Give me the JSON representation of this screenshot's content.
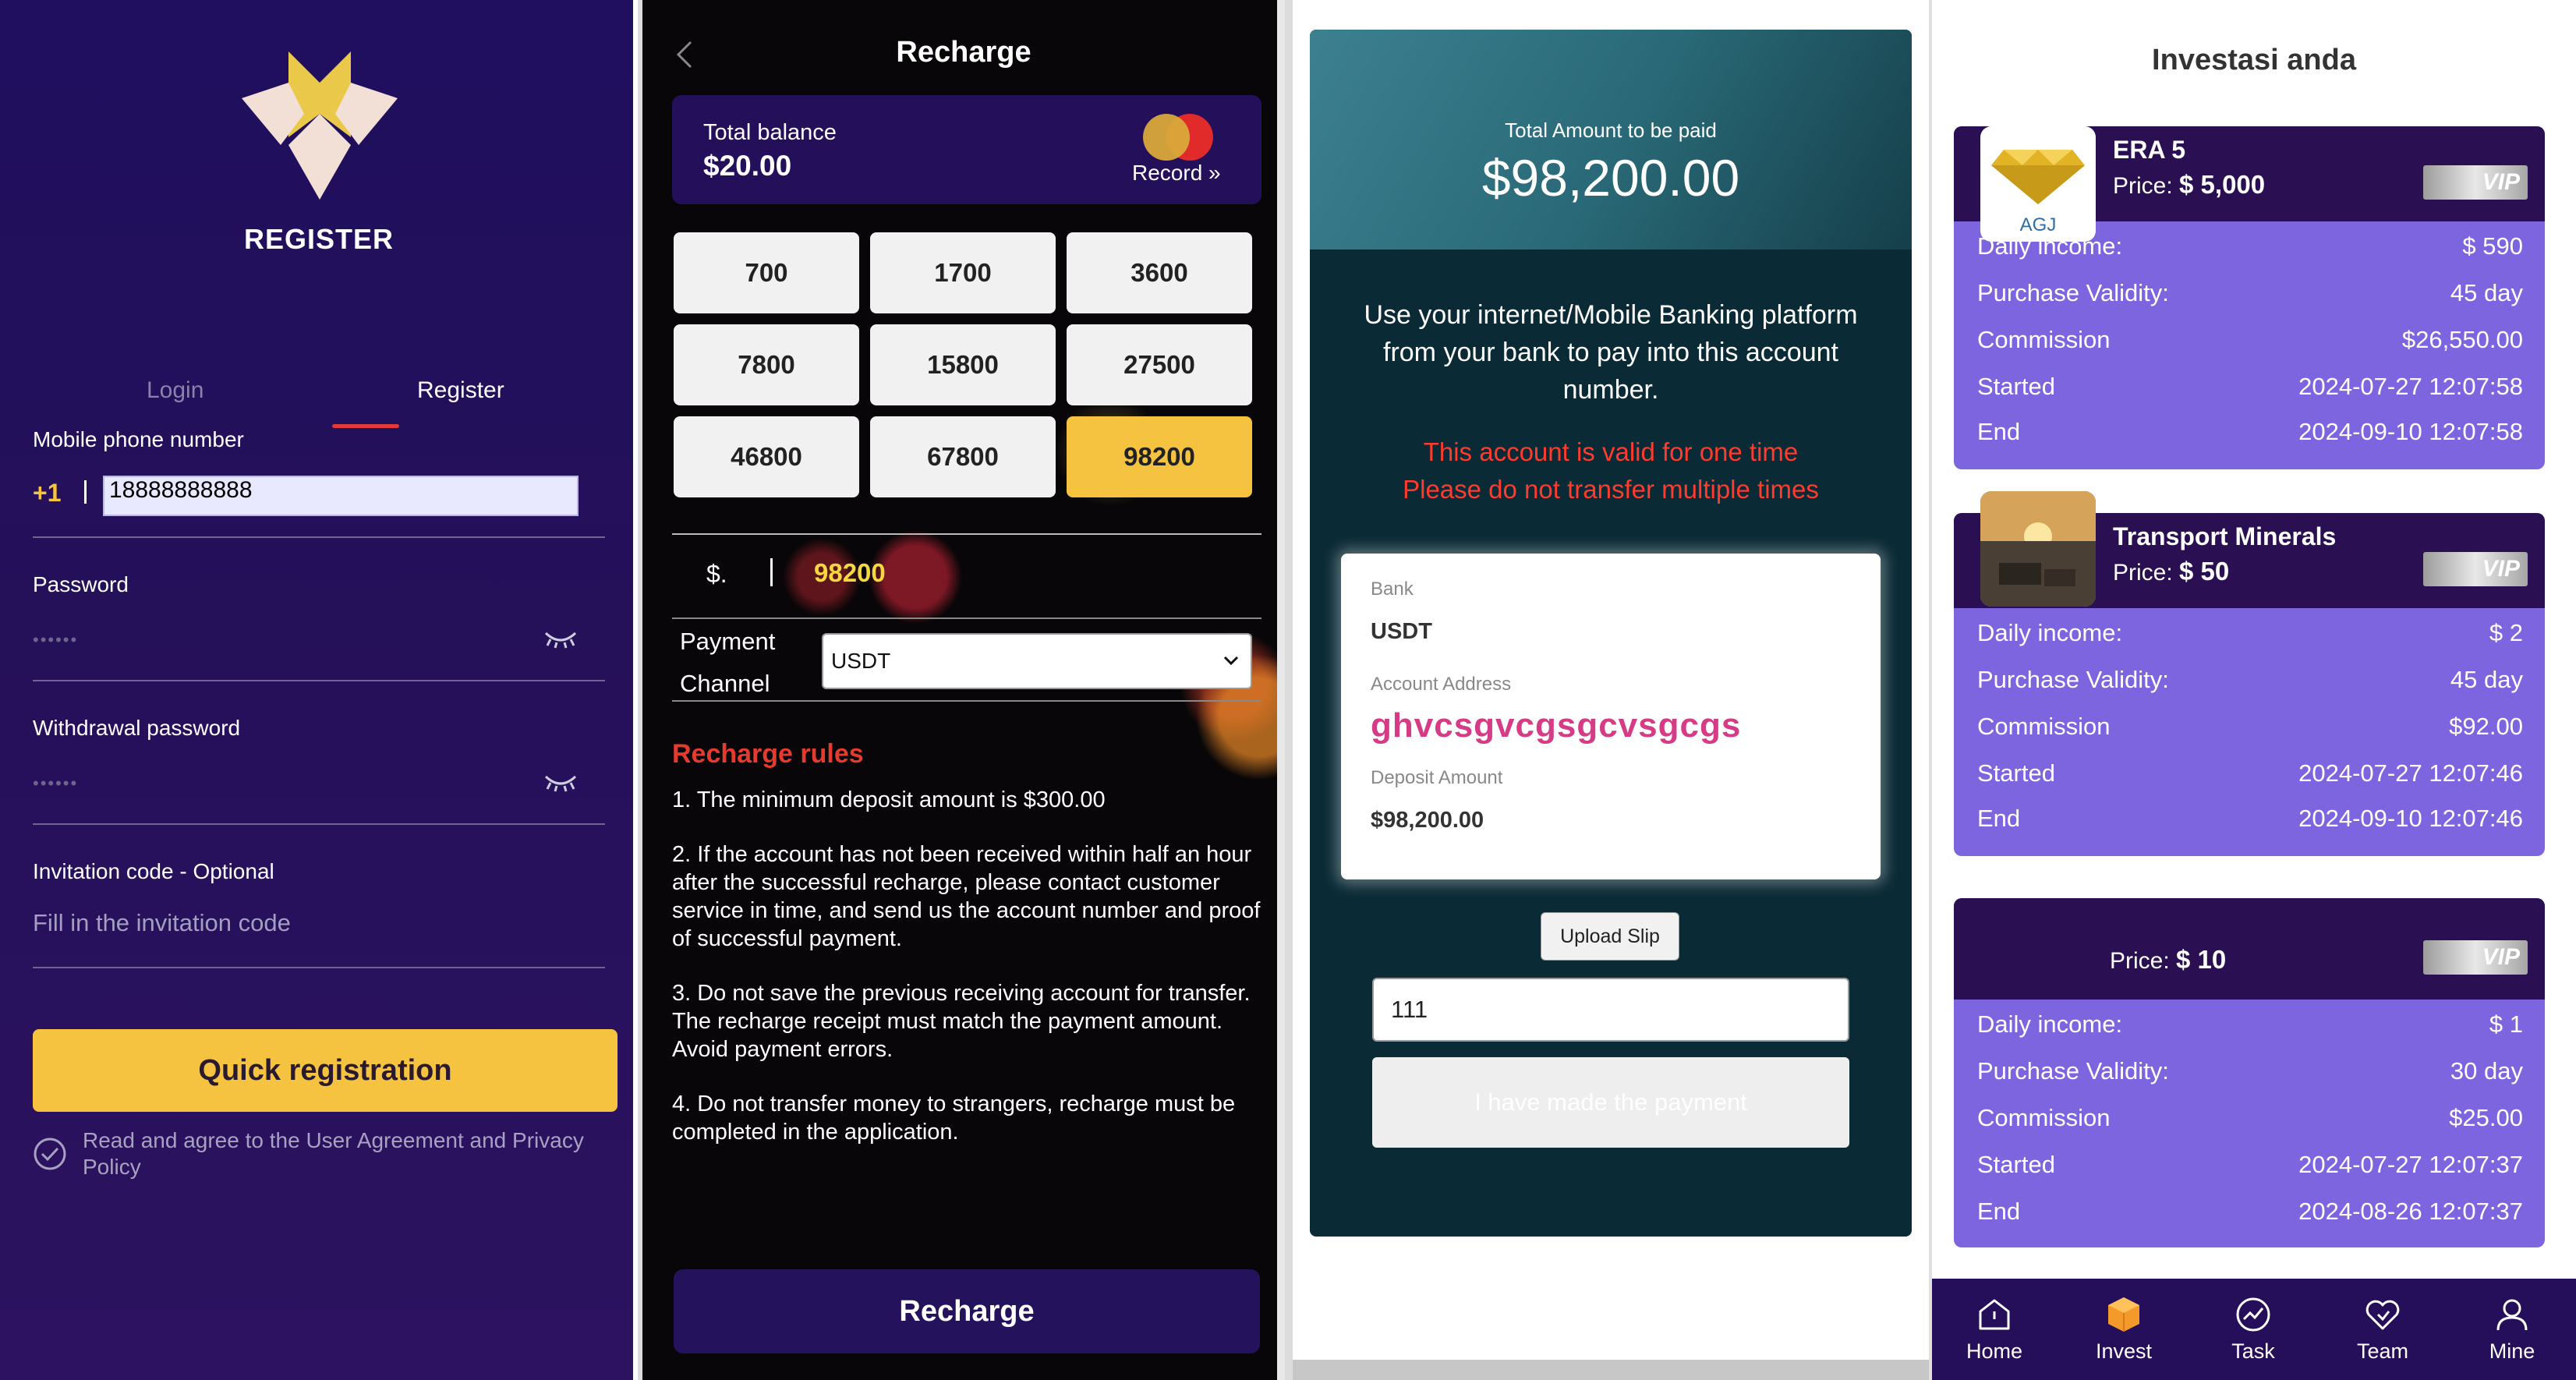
{
  "register": {
    "title": "REGISTER",
    "tab_login": "Login",
    "tab_register": "Register",
    "phone_label": "Mobile phone number",
    "country_code": "+1",
    "phone_value": "18888888888",
    "password_label": "Password",
    "password_dots": "••••••",
    "withdrawal_label": "Withdrawal password",
    "withdrawal_dots": "••••••",
    "invitation_label": "Invitation code - Optional",
    "invitation_placeholder": "Fill in the invitation code",
    "submit": "Quick registration",
    "agreement": "Read and agree to the User Agreement and Privacy Policy",
    "colors": {
      "accent": "#f5c33f",
      "bg": "#1f0f5e",
      "tab_indicator": "#e23a3a"
    }
  },
  "recharge": {
    "title": "Recharge",
    "balance_label": "Total balance",
    "balance_value": "$20.00",
    "record": "Record »",
    "amounts": [
      "700",
      "1700",
      "3600",
      "7800",
      "15800",
      "27500",
      "46800",
      "67800",
      "98200"
    ],
    "selected_amount": "98200",
    "currency_prefix": "$.",
    "amount_value": "98200",
    "payment_channel_label": "Payment Channel",
    "payment_channel_value": "USDT",
    "rules_title": "Recharge rules",
    "rules": [
      "1. The minimum deposit amount is $300.00",
      "2. If the account has not been received within half an hour after the successful recharge, please contact customer service in time, and send us the account number and proof of successful payment.",
      "3. Do not save the previous receiving account for transfer. The recharge receipt must match the payment amount. Avoid payment errors.",
      "4. Do not transfer money to strangers, recharge must be completed in the application."
    ],
    "submit": "Recharge"
  },
  "payment": {
    "total_label": "Total Amount to be paid",
    "total_value": "$98,200.00",
    "instructions": "Use your internet/Mobile Banking platform from your bank to pay into this account number.",
    "warning_line1": "This account is valid for one time",
    "warning_line2": "Please do not transfer multiple times",
    "bank_label": "Bank",
    "bank_value": "USDT",
    "address_label": "Account Address",
    "address_value": "ghvcsgvcgsgcvsgcgs",
    "deposit_label": "Deposit Amount",
    "deposit_value": "$98,200.00",
    "upload_button": "Upload Slip",
    "slip_value": "111",
    "confirm_button": "I have made the payment"
  },
  "investments": {
    "title": "Investasi anda",
    "labels": {
      "daily": "Daily income:",
      "validity": "Purchase Validity:",
      "commission": "Commission",
      "started": "Started",
      "end": "End",
      "price": "Price:",
      "vip": "VIP"
    },
    "items": [
      {
        "name": "ERA 5",
        "logo_text": "AGJ",
        "price": "$ 5,000",
        "daily": "$ 590",
        "validity": "45 day",
        "commission": "$26,550.00",
        "started": "2024-07-27 12:07:58",
        "end": "2024-09-10 12:07:58"
      },
      {
        "name": "Transport Minerals",
        "price": "$ 50",
        "daily": "$ 2",
        "validity": "45 day",
        "commission": "$92.00",
        "started": "2024-07-27 12:07:46",
        "end": "2024-09-10 12:07:46"
      },
      {
        "name": "",
        "price": "$ 10",
        "daily": "$ 1",
        "validity": "30 day",
        "commission": "$25.00",
        "started": "2024-07-27 12:07:37",
        "end": "2024-08-26 12:07:37"
      }
    ],
    "tabs": [
      {
        "label": "Home",
        "icon": "home-icon"
      },
      {
        "label": "Invest",
        "icon": "box-icon"
      },
      {
        "label": "Task",
        "icon": "trend-icon"
      },
      {
        "label": "Team",
        "icon": "team-icon"
      },
      {
        "label": "Mine",
        "icon": "user-icon"
      }
    ],
    "active_tab": "Invest"
  }
}
